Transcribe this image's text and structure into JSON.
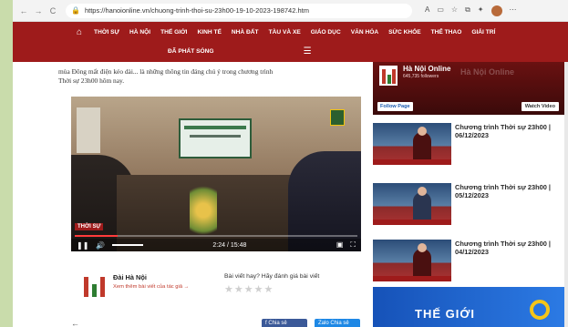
{
  "browser": {
    "url": "https://hanoionline.vn/chuong-trinh-thoi-su-23h00-19-10-2023-198742.htm",
    "nav_back": "←",
    "nav_forward": "→",
    "reload": "C"
  },
  "site_nav": {
    "items": [
      "THỜI SỰ",
      "HÀ NỘI",
      "THẾ GIỚI",
      "KINH TẾ",
      "NHÀ ĐẤT",
      "TÀU VÀ XE",
      "GIÁO DỤC",
      "VĂN HÓA",
      "SỨC KHỎE",
      "THỂ THAO",
      "GIẢI TRÍ"
    ],
    "row2_label": "ĐÃ PHÁT SÓNG"
  },
  "article": {
    "lead_cut": "... ... ... ...",
    "lead_line1": "mùa Đông mất điện kéo dài... là những thông tin đáng chú ý trong chương trình",
    "lead_line2": "Thời sự 23h00 hôm nay."
  },
  "video": {
    "badge": "THỜI SỰ",
    "time": "2:24 / 15:48",
    "progress": 0.153
  },
  "author": {
    "name": "Đài Hà Nội",
    "link": "Xem thêm bài viết của tác giả →",
    "rate_question": "Bài viết hay? Hãy đánh giá bài viết",
    "stars": "★★★★★"
  },
  "share": {
    "facebook": "f Chia sẻ",
    "zalo": "Zalo Chia sẻ"
  },
  "sidebar": {
    "fb_title": "Hà Nội Online",
    "fb_followers": "645,735 followers",
    "fb_watermark": "Hà Nội Online",
    "follow_label": "Follow Page",
    "watch_label": "Watch Video",
    "news": [
      {
        "title": "Chương trình Thời sự 23h00 | 06/12/2023"
      },
      {
        "title": "Chương trình Thời sự 23h00 | 05/12/2023"
      },
      {
        "title": "Chương trình Thời sự 23h00 | 04/12/2023"
      }
    ],
    "banner_text": "THẾ GIỚI"
  }
}
